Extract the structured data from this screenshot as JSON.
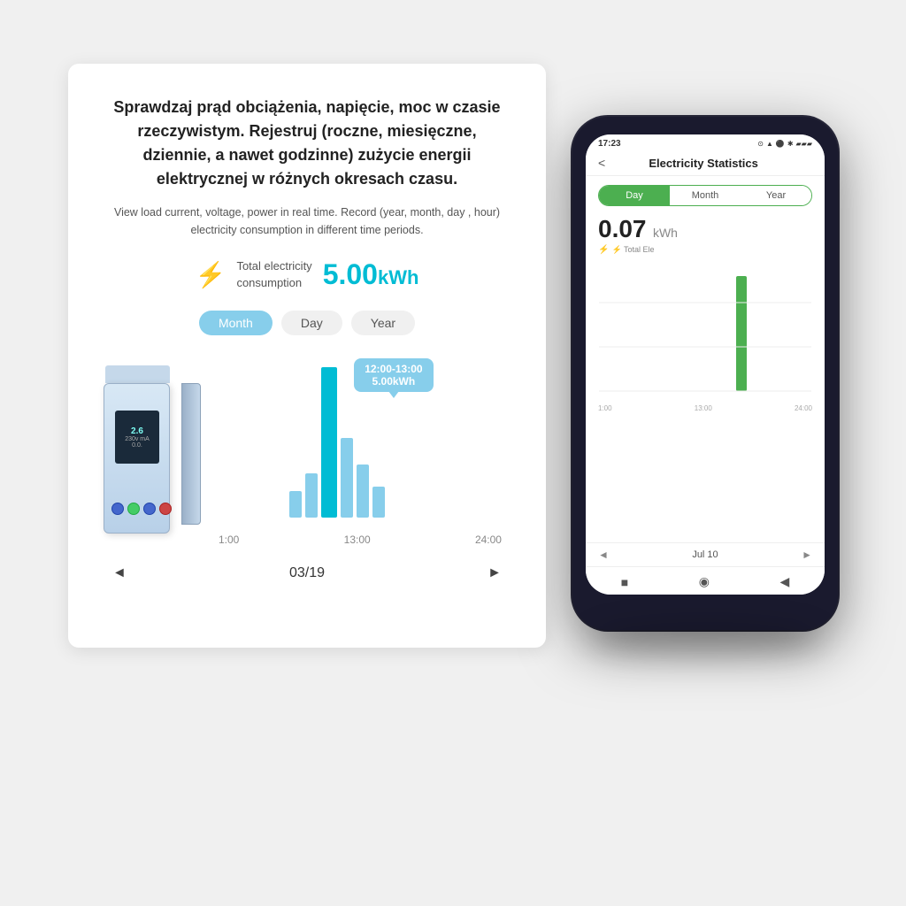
{
  "card": {
    "title_pl": "Sprawdzaj prąd obciążenia, napięcie, moc w czasie rzeczywistym. Rejestruj (roczne, miesięczne, dziennie, a nawet godzinne) zużycie energii elektrycznej w różnych okresach czasu.",
    "subtitle_en": "View load current, voltage, power in real time. Record (year, month, day , hour) electricity consumption in different time periods.",
    "total_label": "Total electricity\nconsumption",
    "total_value": "5.00",
    "total_unit": "kWh",
    "tabs": [
      "Month",
      "Day",
      "Year"
    ],
    "active_tab": "Month",
    "tooltip_time": "12:00-13:00",
    "tooltip_value": "5.00kWh",
    "chart_labels": [
      "1:00",
      "13:00",
      "24:00"
    ],
    "nav_prev": "◄",
    "nav_date": "03/19",
    "nav_next": "►"
  },
  "phone": {
    "status_time": "17:23",
    "status_icons": "⬝ ▲ ⚫ ✱",
    "app_title": "Electricity Statistics",
    "back_label": "<",
    "tabs": [
      "Day",
      "Month",
      "Year"
    ],
    "active_tab": "Day",
    "reading_value": "0.07",
    "reading_unit": "kWh",
    "reading_label": "⚡ Total Ele",
    "chart_labels": [
      "1:00",
      "13:00",
      "24:00"
    ],
    "nav_prev": "◄",
    "nav_date": "Jul 10",
    "nav_next": "►",
    "android_nav": [
      "■",
      "◉",
      "◀"
    ]
  }
}
